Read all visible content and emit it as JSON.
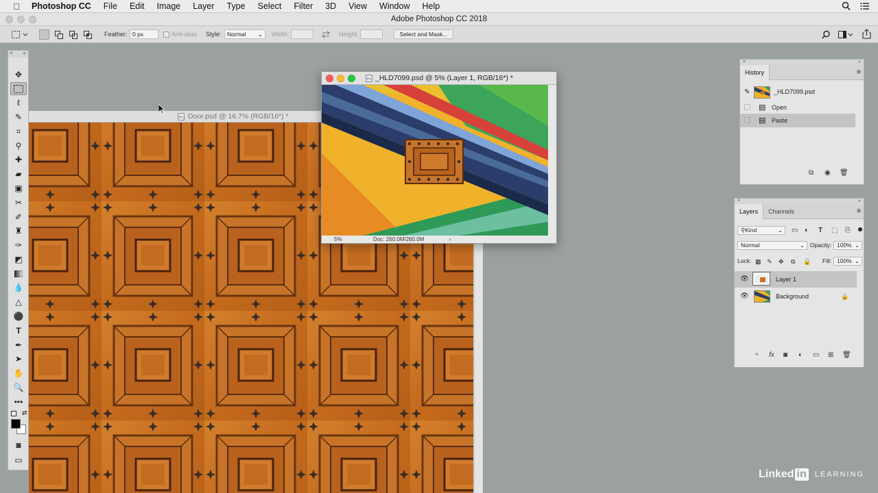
{
  "menubar": {
    "app": "Photoshop CC",
    "items": [
      "File",
      "Edit",
      "Image",
      "Layer",
      "Type",
      "Select",
      "Filter",
      "3D",
      "View",
      "Window",
      "Help"
    ]
  },
  "window_title": "Adobe Photoshop CC 2018",
  "options": {
    "feather_label": "Feather:",
    "feather_value": "0 px",
    "antialias": "Anti-alias",
    "style_label": "Style:",
    "style_value": "Normal",
    "width_label": "Width:",
    "height_label": "Height:",
    "select_mask": "Select and Mask..."
  },
  "door_doc": {
    "title": "Door.psd @ 16.7% (RGB/16*) *"
  },
  "hld_doc": {
    "title": "_HLD7099.psd @ 5% (Layer 1, RGB/16*) *",
    "zoom": "5%",
    "doc_size": "Doc: 260.0M/260.0M"
  },
  "history": {
    "tab": "History",
    "snapshot": "_HLD7099.psd",
    "states": [
      "Open",
      "Paste"
    ]
  },
  "layers": {
    "tabs": [
      "Layers",
      "Channels"
    ],
    "kind": "Kind",
    "blend": "Normal",
    "opacity_label": "Opacity:",
    "opacity_value": "100%",
    "lock_label": "Lock:",
    "fill_label": "Fill:",
    "fill_value": "100%",
    "items": [
      "Layer 1",
      "Background"
    ]
  },
  "branding": {
    "a": "Linked",
    "b": "in",
    "c": "LEARNING"
  },
  "colors": {
    "workspace": "#9ba1a1",
    "door_wood": "#c8731f",
    "selection": "#c4c4c4"
  }
}
